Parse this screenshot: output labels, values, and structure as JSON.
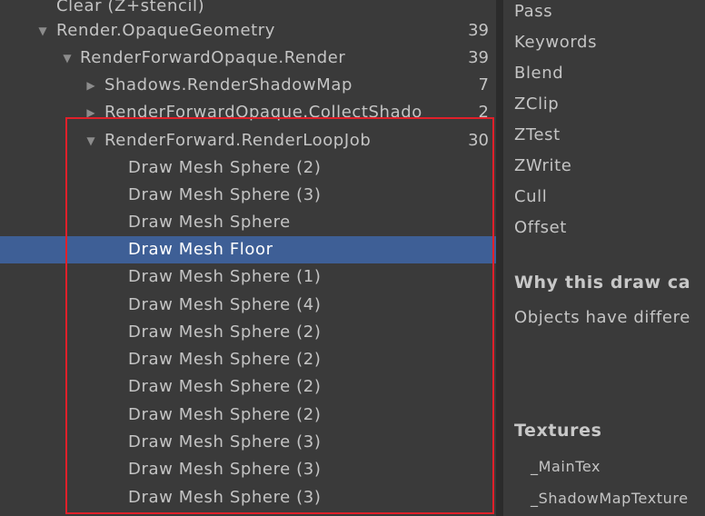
{
  "tree": {
    "rows": [
      {
        "label": "Clear (Z+stencil)",
        "count": "",
        "arrow": ""
      },
      {
        "label": "Render.OpaqueGeometry",
        "count": "39",
        "arrow": "▼"
      },
      {
        "label": "RenderForwardOpaque.Render",
        "count": "39",
        "arrow": "▼"
      },
      {
        "label": "Shadows.RenderShadowMap",
        "count": "7",
        "arrow": "▶"
      },
      {
        "label": "RenderForwardOpaque.CollectShado",
        "count": "2",
        "arrow": "▶"
      },
      {
        "label": "RenderForward.RenderLoopJob",
        "count": "30",
        "arrow": "▼"
      },
      {
        "label": "Draw Mesh Sphere (2)",
        "count": "",
        "arrow": ""
      },
      {
        "label": "Draw Mesh Sphere (3)",
        "count": "",
        "arrow": ""
      },
      {
        "label": "Draw Mesh Sphere",
        "count": "",
        "arrow": ""
      },
      {
        "label": "Draw Mesh Floor",
        "count": "",
        "arrow": "",
        "selected": true
      },
      {
        "label": "Draw Mesh Sphere (1)",
        "count": "",
        "arrow": ""
      },
      {
        "label": "Draw Mesh Sphere (4)",
        "count": "",
        "arrow": ""
      },
      {
        "label": "Draw Mesh Sphere (2)",
        "count": "",
        "arrow": ""
      },
      {
        "label": "Draw Mesh Sphere (2)",
        "count": "",
        "arrow": ""
      },
      {
        "label": "Draw Mesh Sphere (2)",
        "count": "",
        "arrow": ""
      },
      {
        "label": "Draw Mesh Sphere (2)",
        "count": "",
        "arrow": ""
      },
      {
        "label": "Draw Mesh Sphere (3)",
        "count": "",
        "arrow": ""
      },
      {
        "label": "Draw Mesh Sphere (3)",
        "count": "",
        "arrow": ""
      },
      {
        "label": "Draw Mesh Sphere (3)",
        "count": "",
        "arrow": ""
      }
    ]
  },
  "details": {
    "properties": [
      "Pass",
      "Keywords",
      "Blend",
      "ZClip",
      "ZTest",
      "ZWrite",
      "Cull",
      "Offset"
    ],
    "why_heading": "Why this draw ca",
    "why_text": "Objects have differe",
    "textures_heading": "Textures",
    "textures": [
      "_MainTex",
      "_ShadowMapTexture"
    ]
  },
  "colors": {
    "selection": "#3e5f96",
    "highlight_border": "#e0202a"
  }
}
